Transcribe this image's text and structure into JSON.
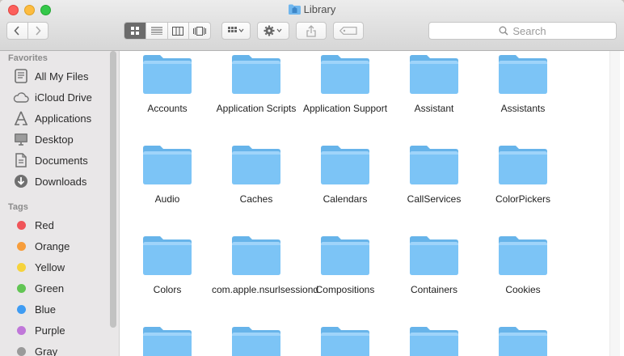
{
  "window": {
    "title": "Library"
  },
  "toolbar": {
    "back_icon": "chevron-left-icon",
    "forward_icon": "chevron-right-icon",
    "view_modes": [
      "icon-view-icon",
      "list-view-icon",
      "column-view-icon",
      "cover-flow-icon"
    ],
    "active_view": "icon-view-icon",
    "arrange_icon": "arrange-grid-icon",
    "action_icon": "gear-icon",
    "share_icon": "share-icon",
    "tags_icon": "tag-icon",
    "search": {
      "placeholder": "Search"
    }
  },
  "sidebar": {
    "favorites_heading": "Favorites",
    "favorites": [
      {
        "label": "All My Files",
        "icon": "all-files-icon"
      },
      {
        "label": "iCloud Drive",
        "icon": "cloud-icon"
      },
      {
        "label": "Applications",
        "icon": "applications-icon"
      },
      {
        "label": "Desktop",
        "icon": "desktop-icon"
      },
      {
        "label": "Documents",
        "icon": "documents-icon"
      },
      {
        "label": "Downloads",
        "icon": "downloads-icon"
      }
    ],
    "tags_heading": "Tags",
    "tags": [
      {
        "label": "Red",
        "color": "#f0555a"
      },
      {
        "label": "Orange",
        "color": "#f79d3b"
      },
      {
        "label": "Yellow",
        "color": "#f6d33c"
      },
      {
        "label": "Green",
        "color": "#62c554"
      },
      {
        "label": "Blue",
        "color": "#3f9cf3"
      },
      {
        "label": "Purple",
        "color": "#c077d9"
      },
      {
        "label": "Gray",
        "color": "#9a9a9a"
      }
    ]
  },
  "folders": [
    {
      "name": "Accounts"
    },
    {
      "name": "Application Scripts"
    },
    {
      "name": "Application Support"
    },
    {
      "name": "Assistant"
    },
    {
      "name": "Assistants"
    },
    {
      "name": "Audio"
    },
    {
      "name": "Caches"
    },
    {
      "name": "Calendars"
    },
    {
      "name": "CallServices"
    },
    {
      "name": "ColorPickers"
    },
    {
      "name": "Colors"
    },
    {
      "name": "com.apple.nsurlsessiond"
    },
    {
      "name": "Compositions"
    },
    {
      "name": "Containers"
    },
    {
      "name": "Cookies"
    },
    {
      "name": ""
    },
    {
      "name": ""
    },
    {
      "name": ""
    },
    {
      "name": ""
    },
    {
      "name": ""
    }
  ],
  "colors": {
    "folder_body": "#7cc4f6",
    "folder_tab": "#67b4ea",
    "accent": "#6b6b6b"
  }
}
